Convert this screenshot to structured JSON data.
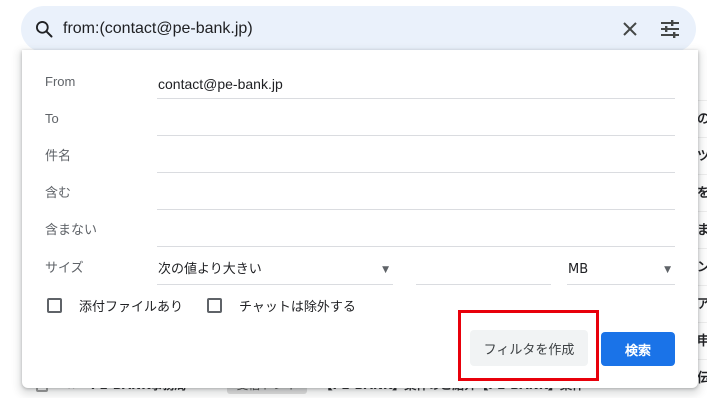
{
  "search": {
    "query": "from:(contact@pe-bank.jp)",
    "icons": {
      "search": "search-icon",
      "clear": "close-icon",
      "options": "tune-icon"
    }
  },
  "form": {
    "from_label": "From",
    "from_value": "contact@pe-bank.jp",
    "to_label": "To",
    "to_value": "",
    "subject_label": "件名",
    "subject_value": "",
    "has_words_label": "含む",
    "has_words_value": "",
    "doesnt_have_label": "含まない",
    "doesnt_have_value": "",
    "size_label": "サイズ",
    "size_operator": "次の値より大きい",
    "size_value": "",
    "size_unit": "MB",
    "has_attachment_label": "添付ファイルあり",
    "exclude_chats_label": "チャットは除外する",
    "create_filter_label": "フィルタを作成",
    "search_button_label": "検索"
  },
  "background": {
    "right_edge_glyphs": [
      "の",
      "ツ",
      "を",
      "ま",
      "ン",
      "ア",
      "申",
      "伝"
    ],
    "bottom_row": {
      "sender": "PE-BANK事務局",
      "tag": "受信トレイ",
      "subject": "【PE-BANK】案件のご紹介【PE-BANK】案件"
    }
  },
  "colors": {
    "search_bar_bg": "#eaf1fb",
    "primary": "#1a73e8",
    "highlight": "#e8000b"
  }
}
